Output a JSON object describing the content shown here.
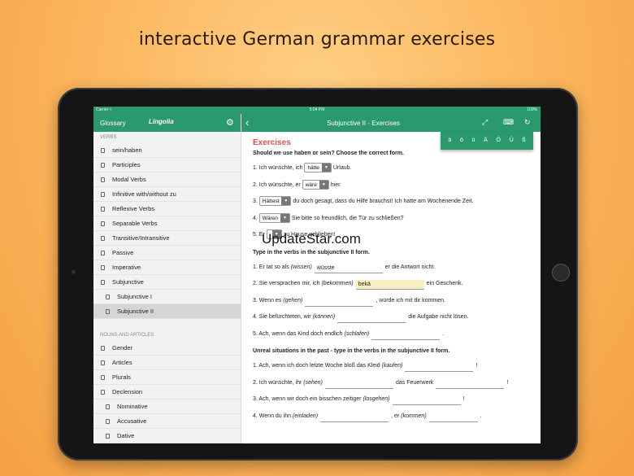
{
  "headline": "interactive German grammar exercises",
  "watermark": "UpdateStar.com",
  "status": {
    "carrier": "Carrier ≈",
    "time": "5:04 PM",
    "battery": "100%"
  },
  "sidebar": {
    "glossary": "Glossary",
    "logo": "Lingolia",
    "verbs_section": "VERBS",
    "verbs": [
      "sein/haben",
      "Participles",
      "Modal Verbs",
      "Infinitive with/without zu",
      "Reflexive Verbs",
      "Separable Verbs",
      "Transitive/Intransitive",
      "Passive",
      "Imperative",
      "Subjunctive"
    ],
    "subjunctive_sub": [
      "Subjunctive I",
      "Subjunctive II"
    ],
    "nouns_section": "NOUNS AND ARTICLES",
    "nouns": [
      "Gender",
      "Articles",
      "Plurals",
      "Declension"
    ],
    "declension_sub": [
      "Nominative",
      "Accusative",
      "Dative"
    ]
  },
  "main": {
    "title": "Subjunctive II - Exercises",
    "umlauts": [
      "ä",
      "ö",
      "ü",
      "Ä",
      "Ö",
      "Ü",
      "ß"
    ],
    "exercises_title": "Exercises",
    "q1": "Should we use haben or sein? Choose the correct form.",
    "q1_rows": [
      {
        "n": "1.",
        "pre": "Ich wünschte, ich",
        "sel": "hätte",
        "post": "Urlaub."
      },
      {
        "n": "2.",
        "pre": "Ich wünschte, er",
        "sel": "wäre",
        "post": "hier."
      },
      {
        "n": "3.",
        "pre": "",
        "sel": "Hättest",
        "post": "du doch gesagt, dass du Hilfe brauchst! Ich hatte am Wochenende Zeit."
      },
      {
        "n": "4.",
        "pre": "",
        "sel": "Wären",
        "post": "Sie bitte so freundlich, die Tür zu schließen?"
      },
      {
        "n": "5.",
        "pre": "Er",
        "sel": "",
        "post": "zu Hause geblieben!"
      }
    ],
    "q2": "Type in the verbs in the subjunctive II form.",
    "q2_rows": [
      {
        "n": "1.",
        "pre": "Er tat so als",
        "hint": "(wissen)",
        "val": "wüsste",
        "post": "er die Antwort nicht."
      },
      {
        "n": "2.",
        "pre": "Sie versprachen mir, ich",
        "hint": "(bekommen)",
        "val": "bekä",
        "post": "ein Geschenk."
      },
      {
        "n": "3.",
        "pre": "Wenn es",
        "hint": "(gehen)",
        "val": "",
        "post": ", würde ich mit dir kommen."
      },
      {
        "n": "4.",
        "pre": "Sie befürchteten, wir",
        "hint": "(können)",
        "val": "",
        "post": "die Aufgabe nicht lösen."
      },
      {
        "n": "5.",
        "pre": "Ach, wenn das Kind doch endlich",
        "hint": "(schlafen)",
        "val": "",
        "post": "."
      }
    ],
    "q3": "Unreal situations in the past - type in the verbs in the subjunctive II form.",
    "q3_rows": [
      {
        "n": "1.",
        "pre": "Ach, wenn ich doch letzte Woche bloß das Kleid",
        "hint": "(kaufen)",
        "post": "!"
      },
      {
        "n": "2.",
        "pre": "Ich wünschte, ihr",
        "hint": "(sehen)",
        "mid": "das Feuerwerk",
        "post": "!"
      },
      {
        "n": "3.",
        "pre": "Ach, wenn wir doch ein bisschen zeitiger",
        "hint": "(losgehen)",
        "post": "!"
      },
      {
        "n": "4.",
        "pre": "Wenn du ihn",
        "hint": "(einladen)",
        "mid": ", er",
        "hint2": "(kommen)",
        "post": "."
      }
    ]
  }
}
